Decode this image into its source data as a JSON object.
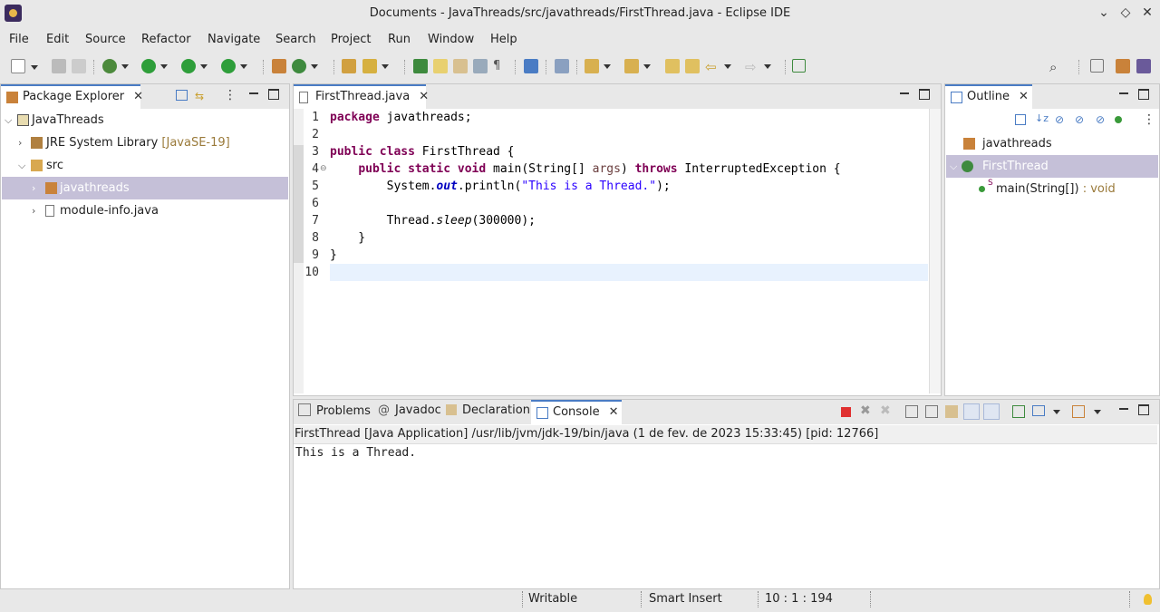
{
  "window": {
    "title": "Documents - JavaThreads/src/javathreads/FirstThread.java - Eclipse IDE"
  },
  "menu": [
    "File",
    "Edit",
    "Source",
    "Refactor",
    "Navigate",
    "Search",
    "Project",
    "Run",
    "Window",
    "Help"
  ],
  "package_explorer": {
    "title": "Package Explorer",
    "tree": {
      "project": "JavaThreads",
      "jre": "JRE System Library",
      "jre_version": "[JavaSE-19]",
      "src": "src",
      "package": "javathreads",
      "module": "module-info.java"
    }
  },
  "editor": {
    "tab": "FirstThread.java",
    "lines": [
      {
        "n": "1",
        "parts": [
          [
            "kw",
            "package"
          ],
          [
            "t",
            " javathreads;"
          ]
        ]
      },
      {
        "n": "2",
        "parts": []
      },
      {
        "n": "3",
        "parts": [
          [
            "kw",
            "public"
          ],
          [
            "t",
            " "
          ],
          [
            "kw",
            "class"
          ],
          [
            "t",
            " FirstThread {"
          ]
        ]
      },
      {
        "n": "4",
        "parts": [
          [
            "t",
            "    "
          ],
          [
            "kw",
            "public"
          ],
          [
            "t",
            " "
          ],
          [
            "kw",
            "static"
          ],
          [
            "t",
            " "
          ],
          [
            "kw",
            "void"
          ],
          [
            "t",
            " main(String[] "
          ],
          [
            "param",
            "args"
          ],
          [
            "t",
            ") "
          ],
          [
            "kw",
            "throws"
          ],
          [
            "t",
            " InterruptedException {"
          ]
        ]
      },
      {
        "n": "5",
        "parts": [
          [
            "t",
            "        System."
          ],
          [
            "fld",
            "out"
          ],
          [
            "t",
            ".println("
          ],
          [
            "str",
            "\"This is a Thread.\""
          ],
          [
            "t",
            ");"
          ]
        ]
      },
      {
        "n": "6",
        "parts": []
      },
      {
        "n": "7",
        "parts": [
          [
            "t",
            "        Thread."
          ],
          [
            "ital",
            "sleep"
          ],
          [
            "t",
            "(300000);"
          ]
        ]
      },
      {
        "n": "8",
        "parts": [
          [
            "t",
            "    }"
          ]
        ]
      },
      {
        "n": "9",
        "parts": [
          [
            "t",
            "}"
          ]
        ]
      },
      {
        "n": "10",
        "parts": []
      }
    ]
  },
  "outline": {
    "title": "Outline",
    "package": "javathreads",
    "class": "FirstThread",
    "method": "main(String[])",
    "method_type": " : void",
    "static_marker": "S"
  },
  "bottom_tabs": {
    "problems": "Problems",
    "javadoc": "Javadoc",
    "declaration": "Declaration",
    "console": "Console"
  },
  "console": {
    "header": "FirstThread [Java Application] /usr/lib/jvm/jdk-19/bin/java  (1 de fev. de 2023 15:33:45) [pid: 12766]",
    "output": "This is a Thread."
  },
  "status": {
    "writable": "Writable",
    "insert_mode": "Smart Insert",
    "position": "10 : 1 : 194"
  },
  "colors": {
    "accent": "#4a7cc4",
    "selection": "#c5c0d8",
    "keyword": "#7f0055",
    "string": "#2a00ff",
    "current_line": "#e8f2fe"
  }
}
